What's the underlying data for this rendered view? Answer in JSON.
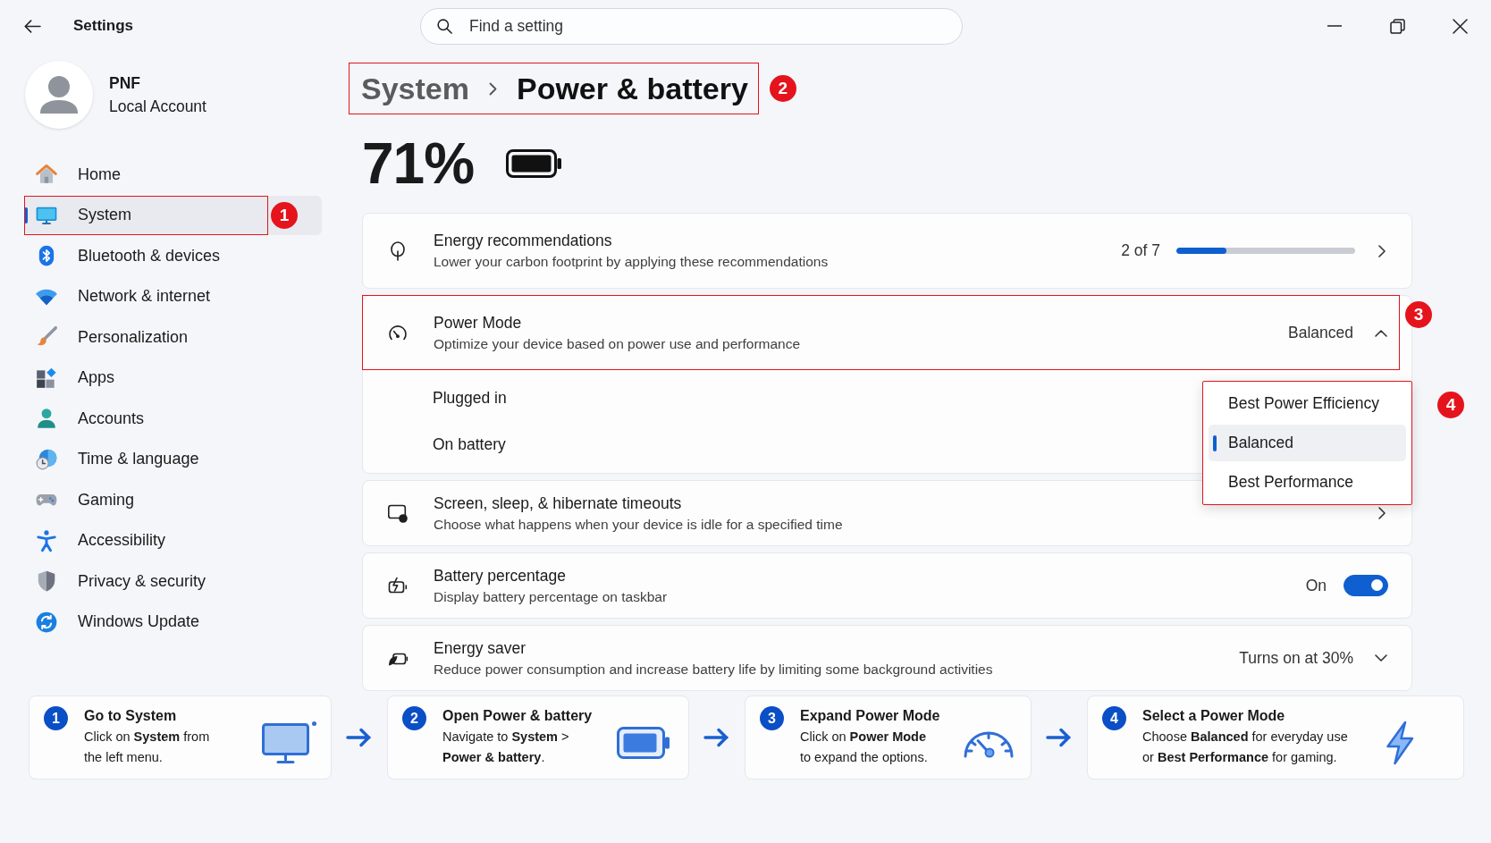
{
  "window": {
    "title": "Settings"
  },
  "search": {
    "placeholder": "Find a setting"
  },
  "account": {
    "name": "PNF",
    "type": "Local Account"
  },
  "sidebar": {
    "items": [
      {
        "label": "Home",
        "selected": false
      },
      {
        "label": "System",
        "selected": true,
        "annotation": "1"
      },
      {
        "label": "Bluetooth & devices",
        "selected": false
      },
      {
        "label": "Network & internet",
        "selected": false
      },
      {
        "label": "Personalization",
        "selected": false
      },
      {
        "label": "Apps",
        "selected": false
      },
      {
        "label": "Accounts",
        "selected": false
      },
      {
        "label": "Time & language",
        "selected": false
      },
      {
        "label": "Gaming",
        "selected": false
      },
      {
        "label": "Accessibility",
        "selected": false
      },
      {
        "label": "Privacy & security",
        "selected": false
      },
      {
        "label": "Windows Update",
        "selected": false
      }
    ]
  },
  "breadcrumb": {
    "parent": "System",
    "current": "Power & battery",
    "annotation": "2"
  },
  "battery": {
    "percent": "71%"
  },
  "cards": [
    {
      "kind": "link",
      "title": "Energy recommendations",
      "description": "Lower your carbon footprint by applying these recommendations",
      "progress": {
        "text": "2 of 7",
        "level": 0.28
      }
    },
    {
      "kind": "expander",
      "title": "Power Mode",
      "description": "Optimize your device based on power use and performance",
      "value": "Balanced",
      "expanded": true,
      "annotation": "3",
      "rows": [
        "Plugged in",
        "On battery"
      ],
      "dropdown": {
        "annotation": "4",
        "options": [
          {
            "label": "Best Power Efficiency",
            "selected": false
          },
          {
            "label": "Balanced",
            "selected": true
          },
          {
            "label": "Best Performance",
            "selected": false
          }
        ]
      }
    },
    {
      "kind": "link",
      "title": "Screen, sleep, & hibernate timeouts",
      "description": "Choose what happens when your device is idle for a specified time"
    },
    {
      "kind": "toggle",
      "title": "Battery percentage",
      "description": "Display battery percentage on taskbar",
      "state_text": "On",
      "on": true
    },
    {
      "kind": "expander",
      "title": "Energy saver",
      "description": "Reduce power consumption and increase battery life by limiting some background activities",
      "value": "Turns on at 30%",
      "expanded": false
    }
  ],
  "steps": [
    {
      "number": "1",
      "title": "Go to System",
      "lines": [
        "Click on **System** from",
        "the left menu."
      ]
    },
    {
      "number": "2",
      "title": "Open Power & battery",
      "lines": [
        "Navigate to **System** >",
        "**Power & battery**."
      ]
    },
    {
      "number": "3",
      "title": "Expand Power Mode",
      "lines": [
        "Click on **Power Mode**",
        "to expand the options."
      ]
    },
    {
      "number": "4",
      "title": "Select a Power Mode",
      "lines": [
        "Choose **Balanced** for everyday use",
        "or **Best Performance** for gaming."
      ]
    }
  ]
}
